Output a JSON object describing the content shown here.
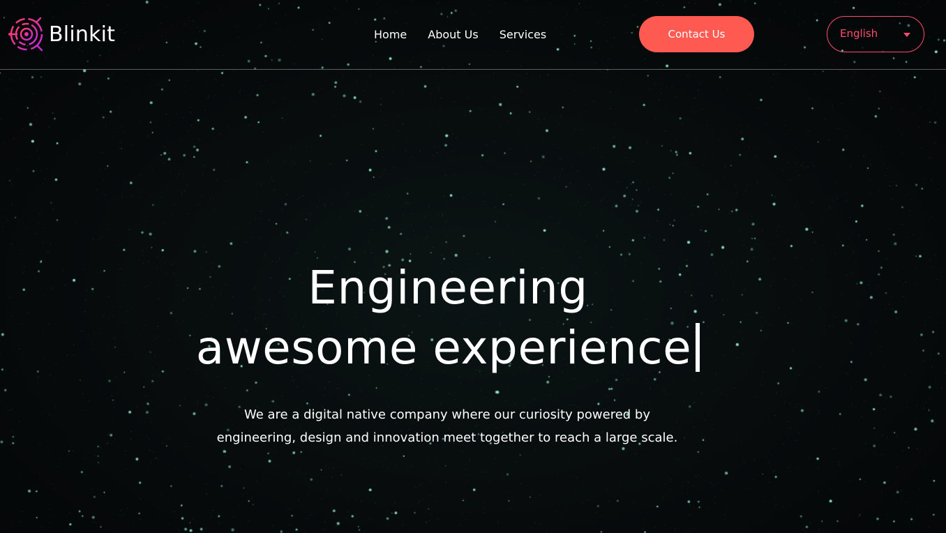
{
  "header": {
    "brand": "Blinkit",
    "nav": [
      {
        "label": "Home"
      },
      {
        "label": "About Us"
      },
      {
        "label": "Services"
      }
    ],
    "contact_label": "Contact Us",
    "language": {
      "selected": "English",
      "icon": "caret-down-icon"
    },
    "logo_icon": "blinkit-logo-icon"
  },
  "hero": {
    "title_line1": "Engineering",
    "title_line2": "awesome experience",
    "subtitle_line1": "We are a digital native company where our curiosity powered by",
    "subtitle_line2": "engineering, design and innovation meet together to reach a large scale."
  },
  "colors": {
    "accent": "#ff5a52",
    "accent_outline": "#ff4d6d",
    "background": "#06090a",
    "text": "#ffffff",
    "stars": "#8fe3c8"
  }
}
